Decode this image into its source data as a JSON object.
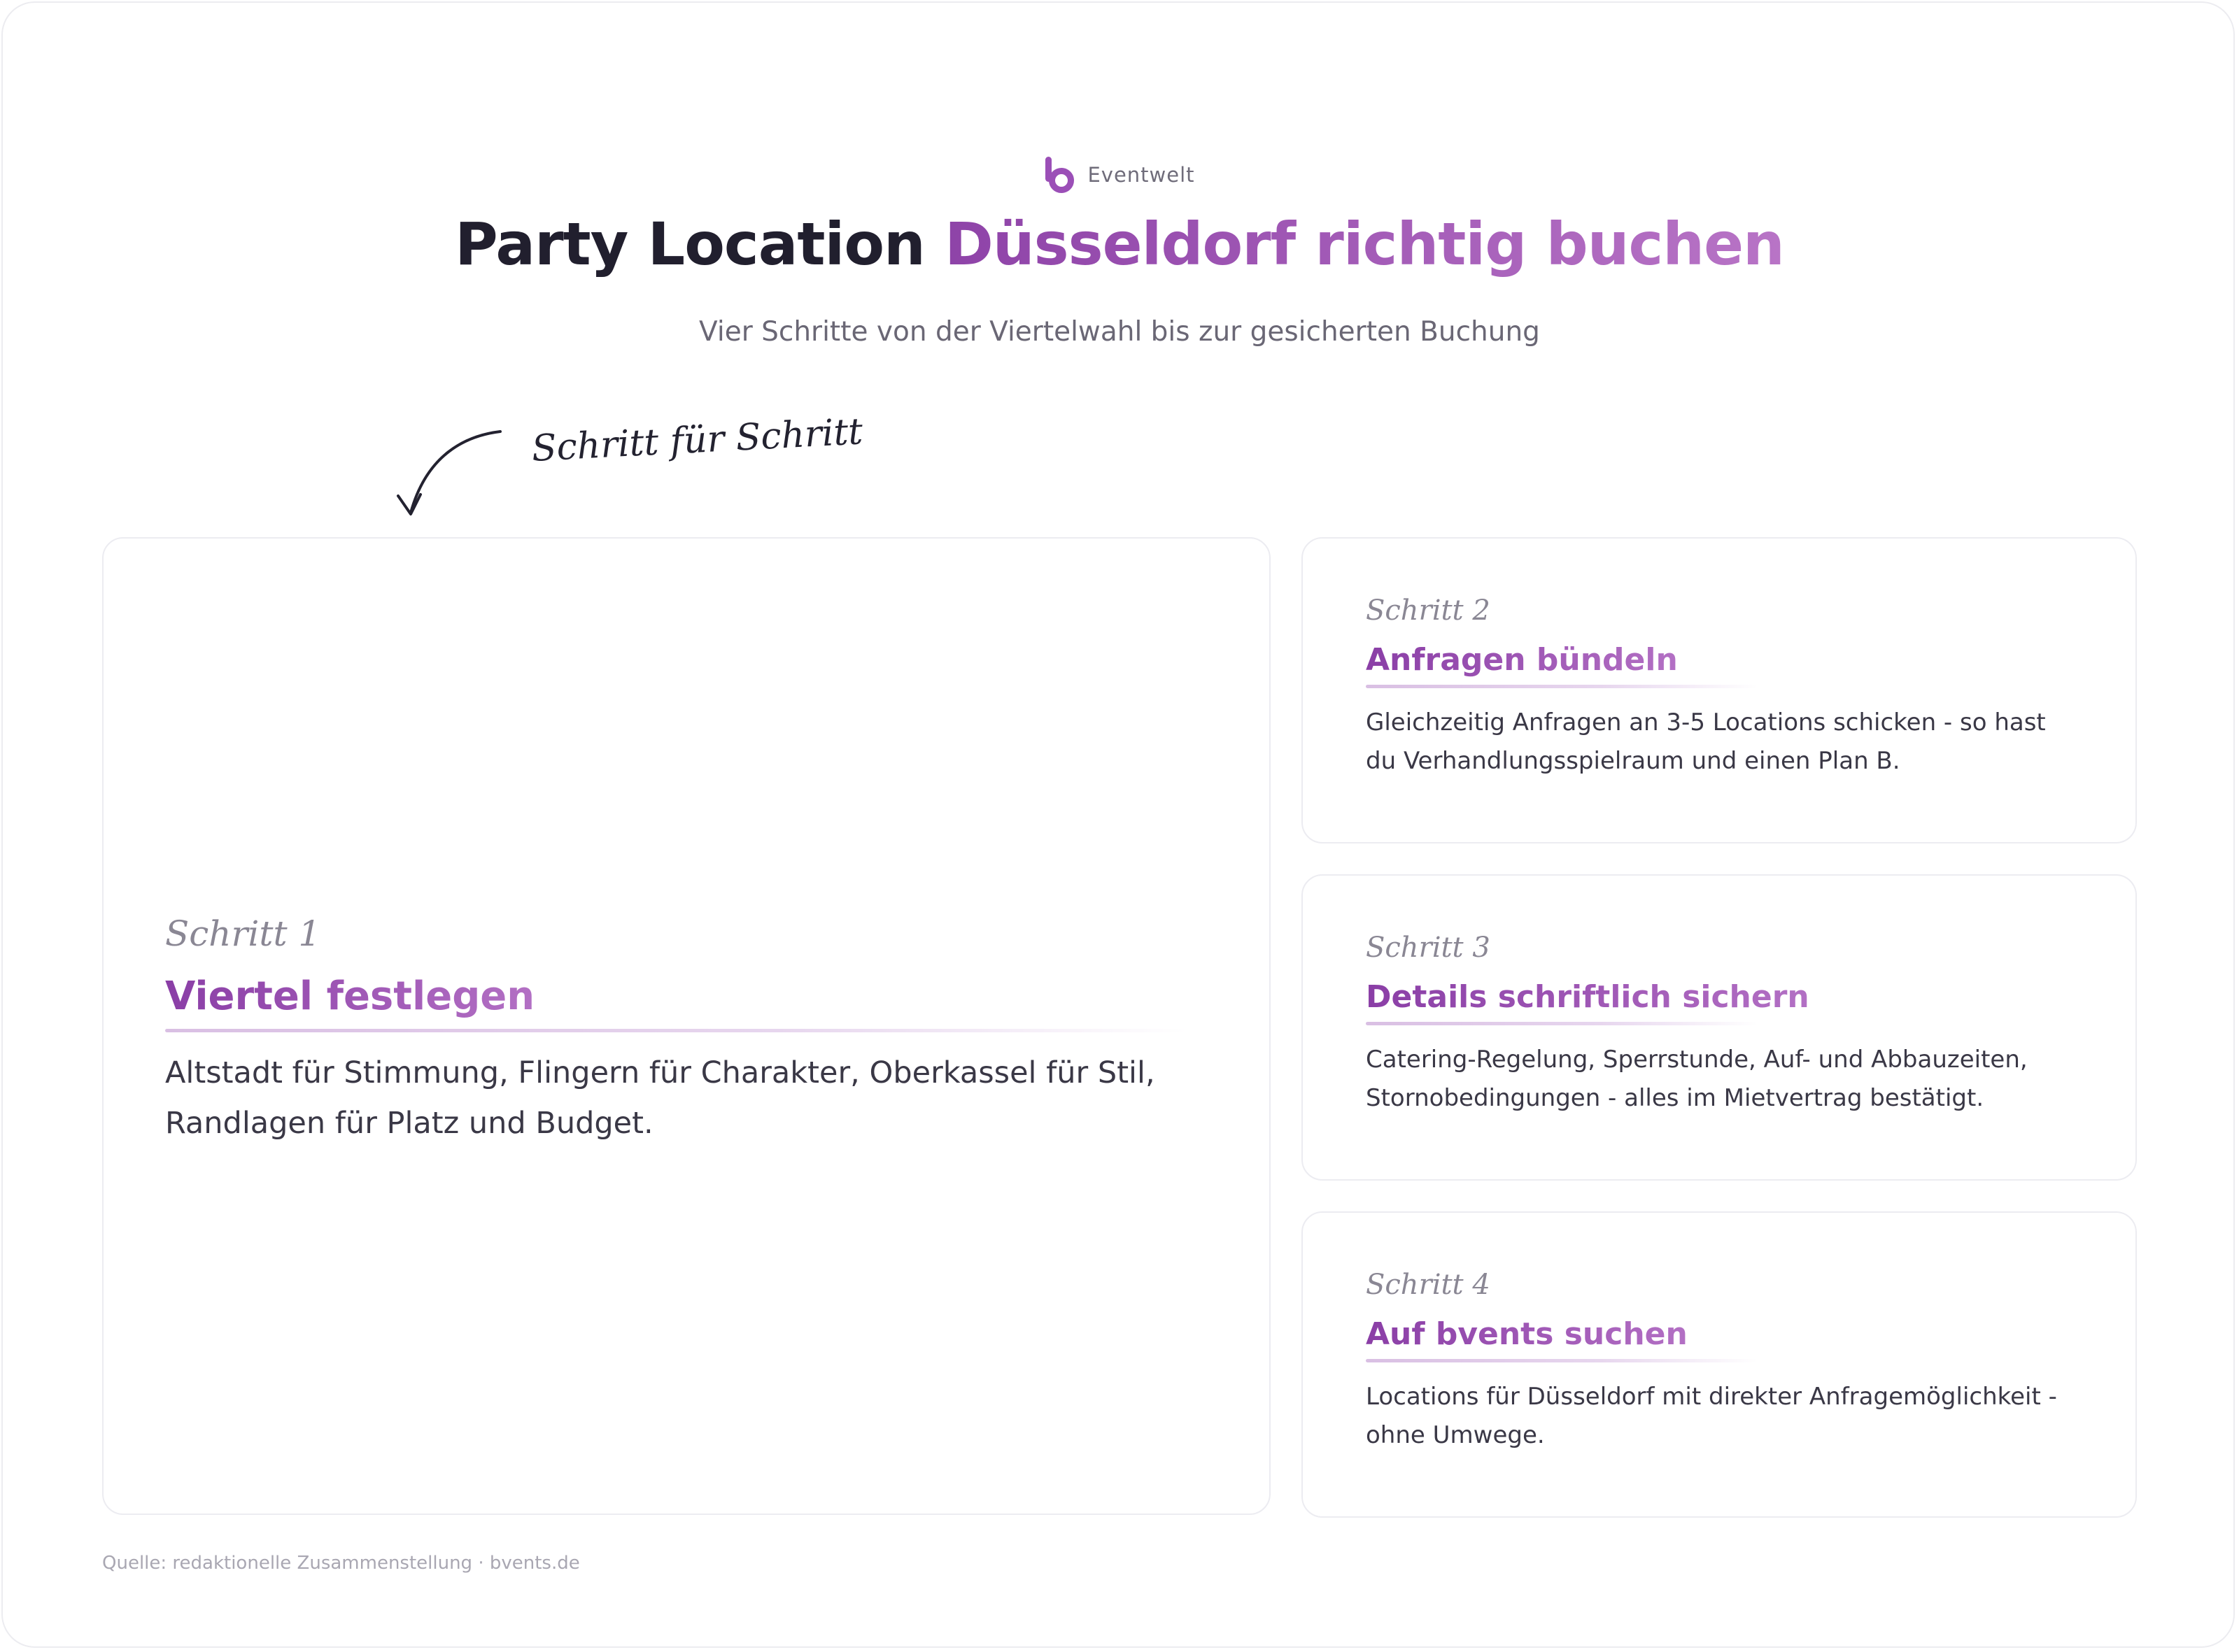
{
  "brand": {
    "logo_icon": "b-logo-icon",
    "name": "Eventwelt",
    "accent_color": "#9b4fb7"
  },
  "header": {
    "title_main": "Party Location ",
    "title_accent": "Düsseldorf richtig buchen",
    "subtitle": "Vier Schritte von der Viertelwahl bis zur gesicherten Buchung"
  },
  "hint": {
    "text": "Schritt für Schritt",
    "icon": "curved-arrow-icon"
  },
  "steps": [
    {
      "label": "Schritt 1",
      "title": "Viertel festlegen",
      "body": "Altstadt für Stimmung, Flingern für Charakter, Oberkassel für Stil, Randlagen für Platz und Budget."
    },
    {
      "label": "Schritt 2",
      "title": "Anfragen bündeln",
      "body": "Gleichzeitig Anfragen an 3-5 Locations schicken - so hast du Verhandlungsspielraum und einen Plan B."
    },
    {
      "label": "Schritt 3",
      "title": "Details schriftlich sichern",
      "body": "Catering-Regelung, Sperrstunde, Auf- und Abbauzeiten, Stornobedingungen - alles im Mietvertrag bestätigt."
    },
    {
      "label": "Schritt 4",
      "title": "Auf bvents suchen",
      "body": "Locations für Düsseldorf mit direkter Anfragemöglichkeit - ohne Umwege."
    }
  ],
  "footer": {
    "source": "Quelle: redaktionelle Zusammenstellung · bvents.de"
  }
}
